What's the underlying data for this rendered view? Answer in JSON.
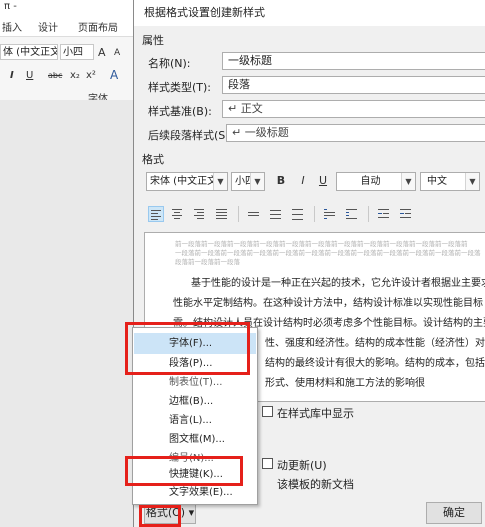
{
  "ribbon": {
    "quick_access": "π -",
    "tabs": [
      "插入",
      "设计",
      "页面布局"
    ],
    "font_name": "体 (中文正文",
    "font_size": "小四",
    "grow_font": "A",
    "shrink_font": "A",
    "format_row": [
      "I",
      "U",
      "abc",
      "x₂",
      "x²",
      "A"
    ],
    "group_label": "字体"
  },
  "dialog": {
    "title": "根据格式设置创建新样式",
    "properties_label": "属性",
    "name_label": "名称(N):",
    "name_value": "一级标题",
    "type_label": "样式类型(T):",
    "type_value": "段落",
    "based_on_label": "样式基准(B):",
    "based_on_value": "↵ 正文",
    "next_label": "后续段落样式(S):",
    "next_value": "↵ 一级标题",
    "format_label": "格式",
    "font_combo": "宋体 (中文正文",
    "size_combo": "小四",
    "bold": "B",
    "italic": "I",
    "underline": "U",
    "color_combo": "自动",
    "lang_combo": "中文",
    "preview_light": [
      "前一段落前一段落前一段落前一段落前一段落前一段落前一段落前一段落前一段落前一段落前一段落前",
      "一段落前一段落前一段落前一段落前一段落前一段落前一段落前一段落前一段落前一段落前一段落前一段落",
      "段落前一段落前一段落"
    ],
    "preview_lines": [
      "基于性能的设计是一种正在兴起的技术，它允许设计者根据业主要求",
      "性能水平定制结构。在这种设计方法中，结构设计标准以实现性能目标",
      "需。结构设计人员在设计结构时必须考虑多个性能目标。设计结构的主要",
      "性、强度和经济性。结构的成本性能（经济性）对业主",
      "结构的最终设计有很大的影响。结构的成本，包括初始",
      "形式、使用材料和施工方法的影响很"
    ],
    "show_in_gallery": "在样式库中显示",
    "auto_update": "动更新(U)",
    "new_docs": "该模板的新文档",
    "format_button": "格式(O) ▾",
    "ok_button": "确定"
  },
  "menu": {
    "items": [
      "字体(F)...",
      "段落(P)...",
      "制表位(T)...",
      "边框(B)...",
      "语言(L)...",
      "图文框(M)...",
      "编号(N)...",
      "快捷键(K)...",
      "文字效果(E)..."
    ]
  },
  "colors": {
    "highlight_box": "#e5201a",
    "menu_hover": "#cce4f7",
    "accent_blue": "#2b579a"
  }
}
